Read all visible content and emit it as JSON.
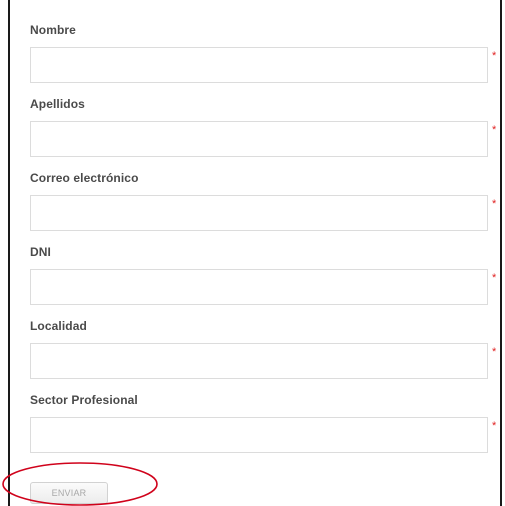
{
  "form": {
    "fields": [
      {
        "label": "Nombre",
        "value": "",
        "required_mark": "*"
      },
      {
        "label": "Apellidos",
        "value": "",
        "required_mark": "*"
      },
      {
        "label": "Correo electrónico",
        "value": "",
        "required_mark": "*"
      },
      {
        "label": "DNI",
        "value": "",
        "required_mark": "*"
      },
      {
        "label": "Localidad",
        "value": "",
        "required_mark": "*"
      },
      {
        "label": "Sector Profesional",
        "value": "",
        "required_mark": "*"
      }
    ],
    "submit_label": "ENVIAR"
  },
  "annotation": {
    "highlight_color": "#d0021b"
  },
  "colors": {
    "required": "#e02020",
    "label": "#4a4a4a",
    "input_border": "#dcdcdc"
  }
}
